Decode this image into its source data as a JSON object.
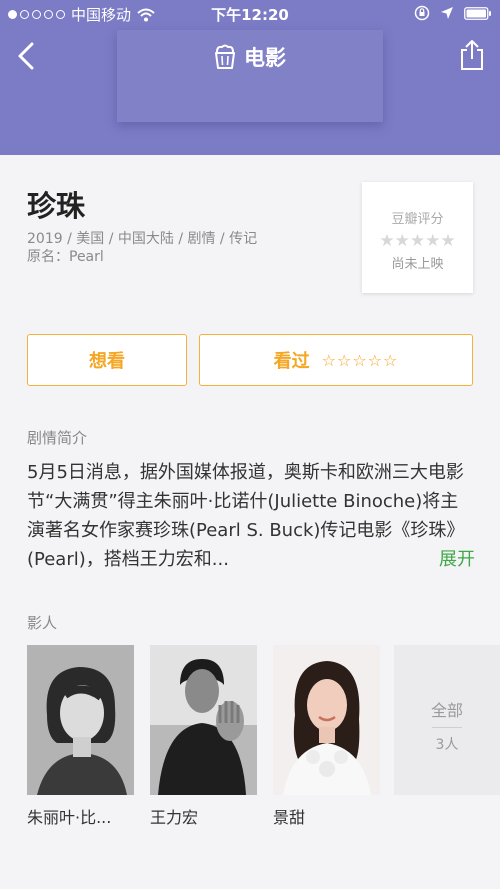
{
  "status_bar": {
    "carrier": "中国移动",
    "time": "下午12:20"
  },
  "nav": {
    "title": "电影"
  },
  "movie": {
    "title": "珍珠",
    "meta_line1": "2019 / 美国 / 中国大陆 / 剧情 / 传记",
    "meta_line2": "原名：Pearl"
  },
  "rating": {
    "label": "豆瓣评分",
    "stars": "★★★★★",
    "status": "尚未上映"
  },
  "actions": {
    "want_label": "想看",
    "seen_label": "看过",
    "seen_stars": "☆☆☆☆☆"
  },
  "synopsis": {
    "heading": "剧情简介",
    "text": "5月5日消息，据外国媒体报道，奥斯卡和欧洲三大电影节“大满贯”得主朱丽叶·比诺什(Juliette Binoche)将主演著名女作家赛珍珠(Pearl S. Buck)传记电影《珍珠》(Pearl)，搭档王力宏和...",
    "expand_label": "展开"
  },
  "cast": {
    "heading": "影人",
    "members": [
      {
        "name": "朱丽叶·比..."
      },
      {
        "name": "王力宏"
      },
      {
        "name": "景甜"
      }
    ],
    "all_label": "全部",
    "all_count": "3人"
  },
  "colors": {
    "header": "#7b7bc6",
    "accent": "#f5a623",
    "expand": "#3fa848"
  }
}
